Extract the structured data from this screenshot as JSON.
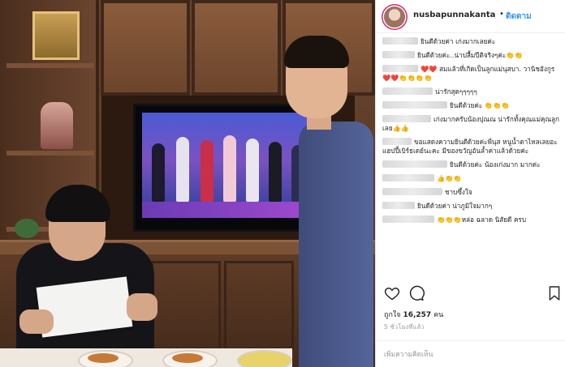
{
  "photo": {
    "tv_caption": ""
  },
  "header": {
    "username": "nusbapunnakanta",
    "separator": "•",
    "follow_label": "ติดตาม"
  },
  "comments": [
    {
      "text": "ยินดีด้วยค่า เก่งมากเลยค่ะ"
    },
    {
      "text": "ยินดีด้วยค่ะ..น่าปลื้มปีติจริงๆค่ะ👏👏"
    },
    {
      "text": "❤️❤️ สมแล้วที่เกิดเป็นลูกแม่นุสบา. วานิชอังกูร❤️❤️👏👏👏👏"
    },
    {
      "text": "น่ารักสุดๆๆๆๆๆ"
    },
    {
      "text": "ยินดีด้วยค่ะ 👏👏👏"
    },
    {
      "text": "เก่งมากครับน้องปุณณ น่ารักทั้งคุณแม่คุณลูกเลย👍👍"
    },
    {
      "text": "ขอแสดงความยินดีด้วยค่ะพี่นุส หนูน้ำตาไหลเลยอะ แฮปปี้เบิร์ธเดย์นะคะ มีของขวัญอันล้ำค่าแล้วด้วยค่ะ"
    },
    {
      "text": "ยินดีด้วยค่ะ น้องเก่งมาก มากค่ะ"
    },
    {
      "text": "👍👏👏"
    },
    {
      "text": "ชาบซึ้งใจ"
    },
    {
      "text": "ยินดีด้วยค่า น่าภูมิใจมากๆ"
    },
    {
      "text": "👏👏👏หล่อ ฉลาด นิสัยดี ครบ"
    }
  ],
  "actions": {
    "like_icon": "heart-icon",
    "comment_icon": "comment-icon",
    "save_icon": "bookmark-icon"
  },
  "likes": {
    "prefix": "ถูกใจ",
    "count": "16,257",
    "suffix": "คน"
  },
  "timestamp": "5 ชั่วโมงที่แล้ว",
  "add_comment_placeholder": "เพิ่มความคิดเห็น"
}
